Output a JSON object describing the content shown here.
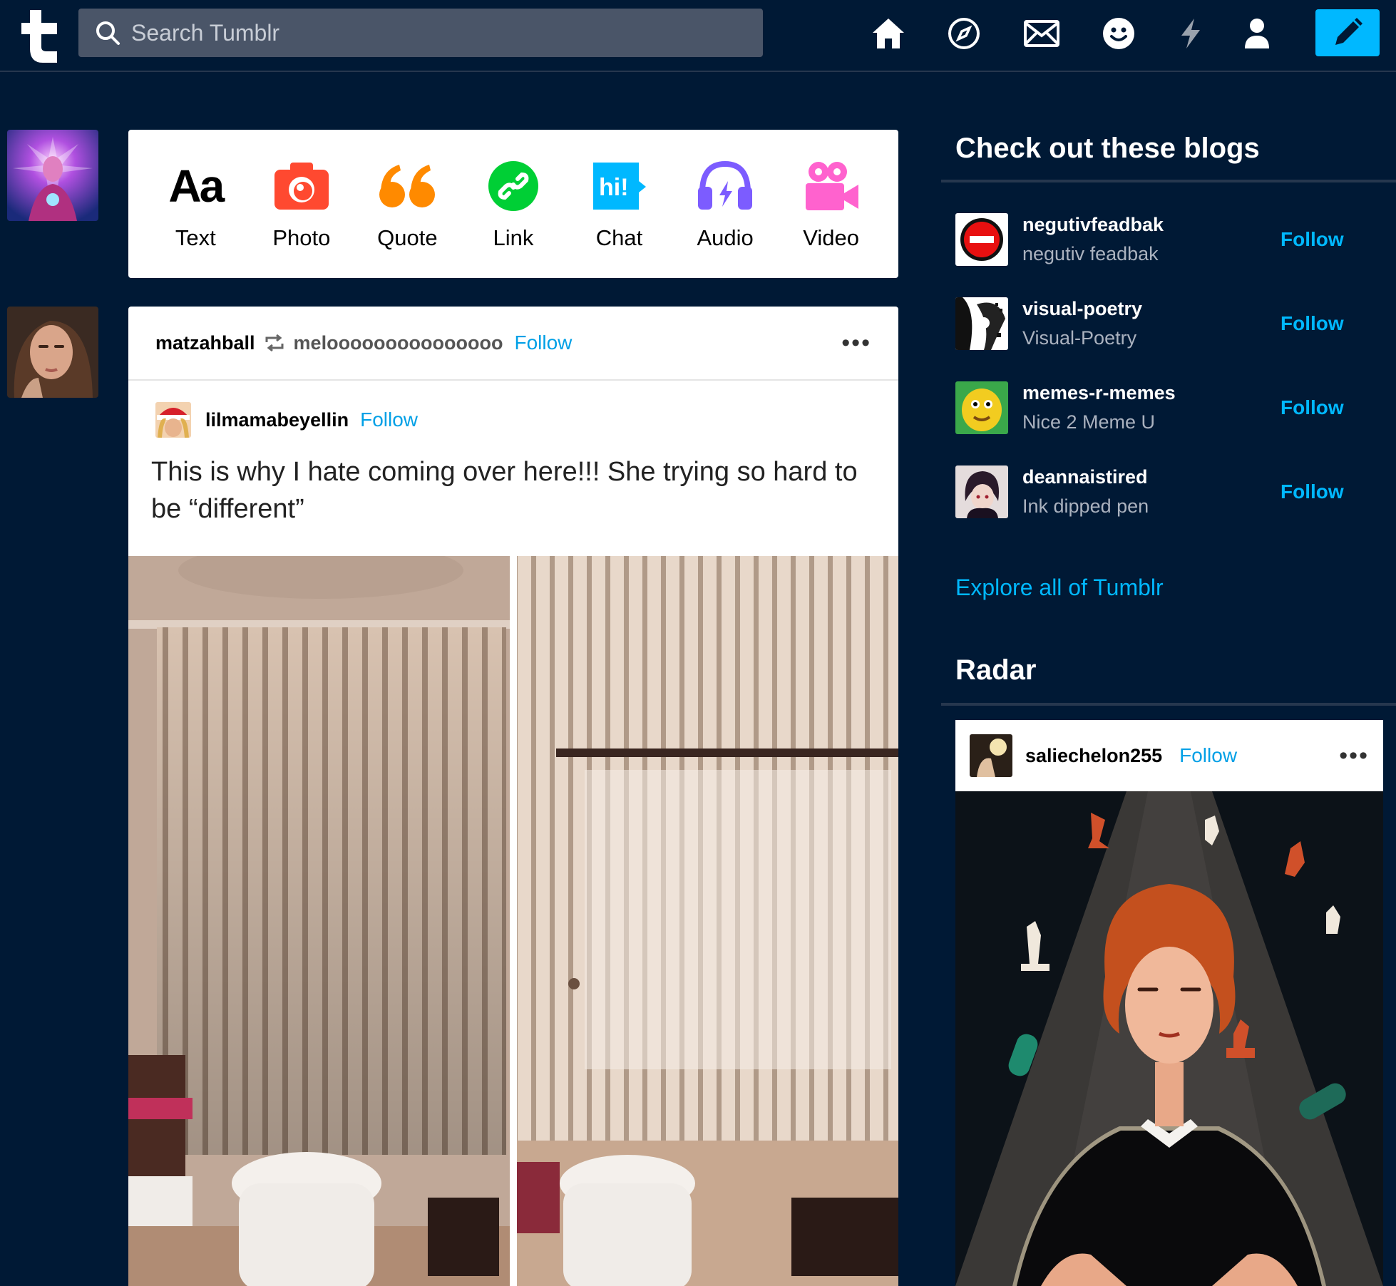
{
  "header": {
    "search_placeholder": "Search Tumblr"
  },
  "post_types": [
    {
      "label": "Text",
      "icon": "text-icon",
      "color": "#000000"
    },
    {
      "label": "Photo",
      "icon": "camera-icon",
      "color": "#ff4930"
    },
    {
      "label": "Quote",
      "icon": "quote-icon",
      "color": "#ff8a00"
    },
    {
      "label": "Link",
      "icon": "link-icon",
      "color": "#00cf35"
    },
    {
      "label": "Chat",
      "icon": "chat-icon",
      "color": "#00b8ff"
    },
    {
      "label": "Audio",
      "icon": "headphones-icon",
      "color": "#7c5cff"
    },
    {
      "label": "Video",
      "icon": "video-camera-icon",
      "color": "#ff62ce"
    }
  ],
  "post": {
    "author": "matzahball",
    "reblogged_from": "melooooooooooooooo",
    "follow_label": "Follow",
    "menu": "•••",
    "source_author": "lilmamabeyellin",
    "source_follow_label": "Follow",
    "text": "This is why I hate coming over here!!! She trying so hard to be “different”"
  },
  "sidebar": {
    "blogs_heading": "Check out these blogs",
    "blogs": [
      {
        "name": "negutivfeadbak",
        "desc": "negutiv feadbak",
        "follow": "Follow"
      },
      {
        "name": "visual-poetry",
        "desc": "Visual-Poetry",
        "follow": "Follow"
      },
      {
        "name": "memes-r-memes",
        "desc": "Nice 2 Meme U",
        "follow": "Follow"
      },
      {
        "name": "deannaistired",
        "desc": "Ink dipped pen",
        "follow": "Follow"
      }
    ],
    "explore": "Explore all of Tumblr",
    "radar_heading": "Radar",
    "radar": {
      "author": "saliechelon255",
      "follow": "Follow",
      "menu": "•••"
    }
  },
  "colors": {
    "background": "#001935",
    "accent": "#00b8ff",
    "search_bg": "#4a5568"
  }
}
